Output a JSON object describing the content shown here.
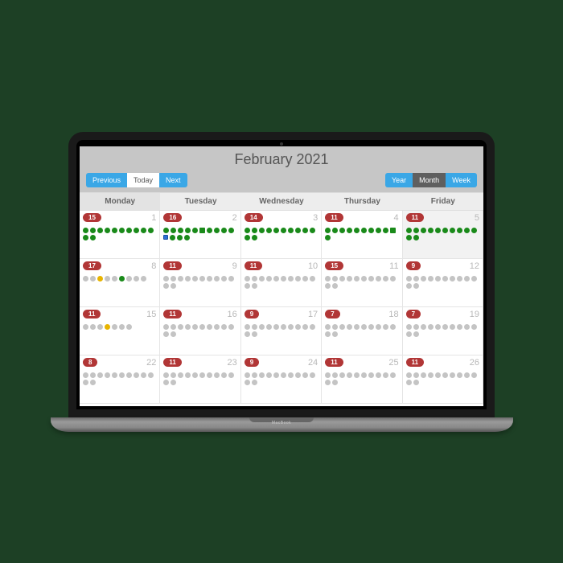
{
  "title": "February 2021",
  "nav": {
    "prev": "Previous",
    "today": "Today",
    "next": "Next"
  },
  "views": {
    "year": "Year",
    "month": "Month",
    "week": "Week"
  },
  "weekdays": [
    "Monday",
    "Tuesday",
    "Wednesday",
    "Thursday",
    "Friday"
  ],
  "laptop_label": "MacBook",
  "cells": [
    {
      "badge": "15",
      "day": "1",
      "today": false,
      "slots": [
        "g",
        "g",
        "g",
        "g",
        "g",
        "g",
        "g",
        "g",
        "g",
        "g",
        "g",
        "g"
      ]
    },
    {
      "badge": "16",
      "day": "2",
      "today": false,
      "slots": [
        "g",
        "g",
        "g",
        "g",
        "g",
        "sg",
        "g",
        "g",
        "g",
        "g",
        "sb",
        "g",
        "g",
        "g"
      ]
    },
    {
      "badge": "14",
      "day": "3",
      "today": false,
      "slots": [
        "g",
        "g",
        "g",
        "g",
        "g",
        "g",
        "g",
        "g",
        "g",
        "g",
        "g",
        "g"
      ]
    },
    {
      "badge": "11",
      "day": "4",
      "today": false,
      "slots": [
        "g",
        "g",
        "g",
        "g",
        "g",
        "g",
        "g",
        "g",
        "g",
        "sg",
        "g"
      ]
    },
    {
      "badge": "11",
      "day": "5",
      "today": true,
      "slots": [
        "g",
        "g",
        "g",
        "g",
        "g",
        "g",
        "g",
        "g",
        "g",
        "g",
        "g",
        "g"
      ]
    },
    {
      "badge": "17",
      "day": "8",
      "today": false,
      "slots": [
        "x",
        "x",
        "y",
        "x",
        "x",
        "g",
        "x",
        "x",
        "x"
      ]
    },
    {
      "badge": "11",
      "day": "9",
      "today": false,
      "slots": [
        "x",
        "x",
        "x",
        "x",
        "x",
        "x",
        "x",
        "x",
        "x",
        "x",
        "x",
        "x"
      ]
    },
    {
      "badge": "11",
      "day": "10",
      "today": false,
      "slots": [
        "x",
        "x",
        "x",
        "x",
        "x",
        "x",
        "x",
        "x",
        "x",
        "x",
        "x",
        "x"
      ]
    },
    {
      "badge": "15",
      "day": "11",
      "today": false,
      "slots": [
        "x",
        "x",
        "x",
        "x",
        "x",
        "x",
        "x",
        "x",
        "x",
        "x",
        "x",
        "x"
      ]
    },
    {
      "badge": "9",
      "day": "12",
      "today": false,
      "slots": [
        "x",
        "x",
        "x",
        "x",
        "x",
        "x",
        "x",
        "x",
        "x",
        "x",
        "x",
        "x"
      ]
    },
    {
      "badge": "11",
      "day": "15",
      "today": false,
      "slots": [
        "x",
        "x",
        "x",
        "y",
        "x",
        "x",
        "x"
      ]
    },
    {
      "badge": "11",
      "day": "16",
      "today": false,
      "slots": [
        "x",
        "x",
        "x",
        "x",
        "x",
        "x",
        "x",
        "x",
        "x",
        "x",
        "x",
        "x"
      ]
    },
    {
      "badge": "9",
      "day": "17",
      "today": false,
      "slots": [
        "x",
        "x",
        "x",
        "x",
        "x",
        "x",
        "x",
        "x",
        "x",
        "x",
        "x",
        "x"
      ]
    },
    {
      "badge": "7",
      "day": "18",
      "today": false,
      "slots": [
        "x",
        "x",
        "x",
        "x",
        "x",
        "x",
        "x",
        "x",
        "x",
        "x",
        "x",
        "x"
      ]
    },
    {
      "badge": "7",
      "day": "19",
      "today": false,
      "slots": [
        "x",
        "x",
        "x",
        "x",
        "x",
        "x",
        "x",
        "x",
        "x",
        "x",
        "x",
        "x"
      ]
    },
    {
      "badge": "8",
      "day": "22",
      "today": false,
      "slots": [
        "x",
        "x",
        "x",
        "x",
        "x",
        "x",
        "x",
        "x",
        "x",
        "x",
        "x",
        "x"
      ]
    },
    {
      "badge": "11",
      "day": "23",
      "today": false,
      "slots": [
        "x",
        "x",
        "x",
        "x",
        "x",
        "x",
        "x",
        "x",
        "x",
        "x",
        "x",
        "x"
      ]
    },
    {
      "badge": "9",
      "day": "24",
      "today": false,
      "slots": [
        "x",
        "x",
        "x",
        "x",
        "x",
        "x",
        "x",
        "x",
        "x",
        "x",
        "x",
        "x"
      ]
    },
    {
      "badge": "11",
      "day": "25",
      "today": false,
      "slots": [
        "x",
        "x",
        "x",
        "x",
        "x",
        "x",
        "x",
        "x",
        "x",
        "x",
        "x",
        "x"
      ]
    },
    {
      "badge": "11",
      "day": "26",
      "today": false,
      "slots": [
        "x",
        "x",
        "x",
        "x",
        "x",
        "x",
        "x",
        "x",
        "x",
        "x",
        "x",
        "x"
      ]
    }
  ]
}
